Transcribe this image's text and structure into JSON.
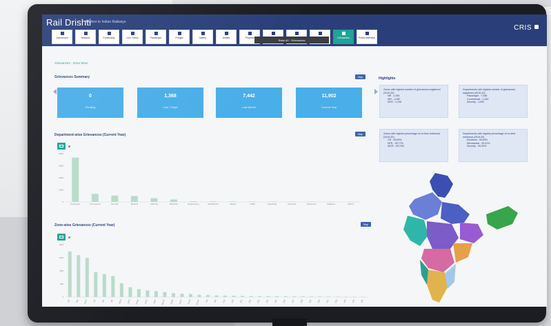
{
  "app": {
    "title": "Rail Drishti",
    "subtitle": "A Mirror to Indian Railways",
    "brand": "CRIS"
  },
  "nav": [
    {
      "label": "Dashboard"
    },
    {
      "label": "Network"
    },
    {
      "label": "Punctuality"
    },
    {
      "label": "Live Trains"
    },
    {
      "label": "Passenger"
    },
    {
      "label": "Freight"
    },
    {
      "label": "Safety"
    },
    {
      "label": "Assets"
    },
    {
      "label": "Projects"
    },
    {
      "label": "Finance"
    },
    {
      "label": "Catering"
    },
    {
      "label": "Cleanliness"
    },
    {
      "label": "Grievances",
      "active": true
    },
    {
      "label": "Public Interface"
    }
  ],
  "tooltip": "Rake #2 · Grievances",
  "breadcrumb": "Grievances · Zone Wise",
  "sections": {
    "summary_title": "Grievances Summary",
    "dept_title": "Department-wise Grievances (Current Year)",
    "zone_title": "Zone-wise Grievances (Current Year)",
    "tag_label": "Map",
    "highlights_title": "Highlights"
  },
  "stats": [
    {
      "value": "0",
      "label": "Pending"
    },
    {
      "value": "1,368",
      "label": "Last 7 Days"
    },
    {
      "value": "7,442",
      "label": "Last Month"
    },
    {
      "value": "11,902",
      "label": "Current Year"
    }
  ],
  "highlights": [
    {
      "title": "Zones with highest number of grievances registered (2019-20)",
      "lines": [
        "NR - 1,394",
        "WR - 1,282",
        "NCR - 1,196"
      ]
    },
    {
      "title": "Departments with highest number of grievances registered (2019-20)",
      "lines": [
        "Passenger - 7,348",
        "Commercial - 1,340",
        "Security - 1,052"
      ]
    },
    {
      "title": "Zones with highest percentage of on-time redressal (2019-20)",
      "lines": [
        "CR - 99.89%",
        "NFR - 99.77%",
        "WCR - 99.74%"
      ]
    },
    {
      "title": "Departments with highest percentage of on-time redressal (2019-20)",
      "lines": [
        "Electrical - 99.63%",
        "Mechanical - 99.41%",
        "Security - 99.29%"
      ]
    }
  ],
  "chart_data": [
    {
      "type": "bar",
      "title": "Department-wise Grievances (Current Year)",
      "categories": [
        "Passenger",
        "Commercial",
        "Security",
        "Medical",
        "Catering",
        "Electrical",
        "Engineering",
        "Mechanical",
        "Signal",
        "Traffic",
        "Operating",
        "Accounts",
        "Personnel",
        "Vigilance",
        "Others"
      ],
      "values": [
        7348,
        1340,
        1052,
        980,
        620,
        410,
        120,
        95,
        80,
        70,
        60,
        55,
        45,
        40,
        35
      ],
      "ylim": [
        0,
        8000
      ],
      "bar_color": "#b8dbc8"
    },
    {
      "type": "bar",
      "title": "Zone-wise Grievances (Current Year)",
      "categories": [
        "NR",
        "WR",
        "NCR",
        "CR",
        "ER",
        "SR",
        "NER",
        "NFR",
        "NWR",
        "SCR",
        "SER",
        "SECR",
        "SWR",
        "WCR",
        "ECR",
        "ECoR",
        "KR",
        "MR",
        "Z19",
        "Z20",
        "Z21",
        "Z22",
        "Z23",
        "Z24",
        "Z25",
        "Z26",
        "Z27",
        "Z28",
        "Z29",
        "Z30",
        "Z31",
        "Z32",
        "Z33",
        "Z34",
        "Z35"
      ],
      "values": [
        1394,
        1282,
        1196,
        760,
        700,
        640,
        420,
        300,
        240,
        200,
        180,
        150,
        120,
        100,
        90,
        70,
        60,
        50,
        45,
        40,
        36,
        32,
        30,
        28,
        26,
        24,
        22,
        20,
        18,
        16,
        14,
        12,
        10,
        8,
        6
      ],
      "ylim": [
        0,
        1600
      ],
      "bar_color": "#b8dbc8"
    }
  ],
  "map": {
    "region": "India"
  }
}
